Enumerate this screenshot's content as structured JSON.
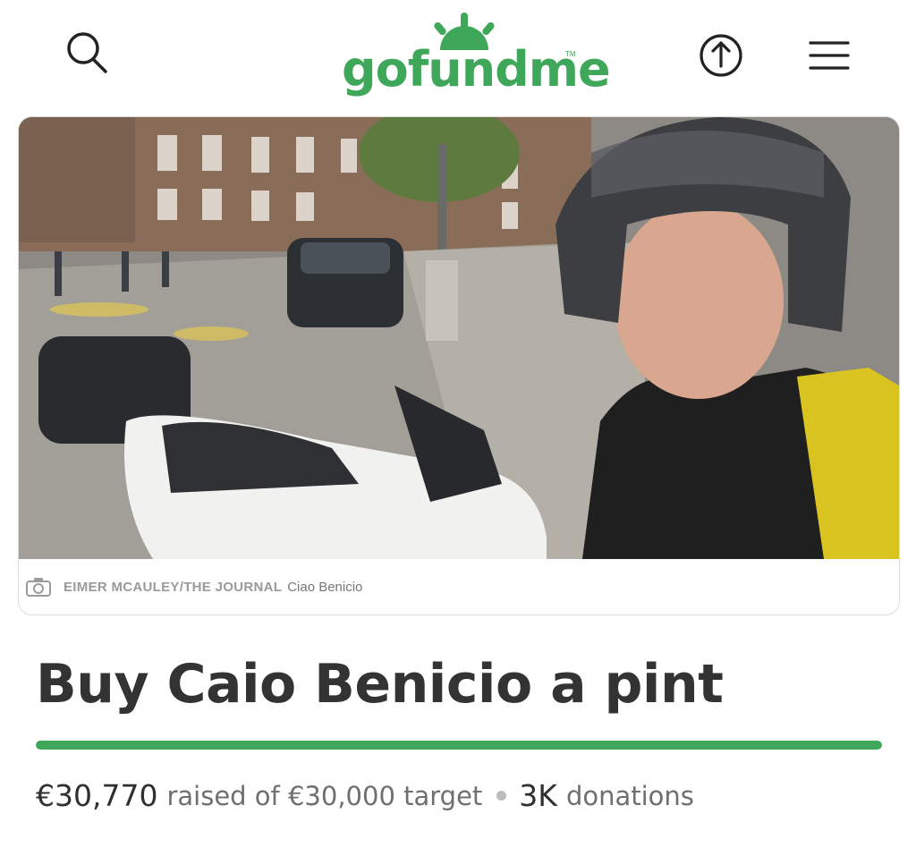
{
  "header": {
    "logo_text": "gofundme",
    "logo_tm": "TM",
    "icons": {
      "search": "search-icon",
      "share": "share-icon",
      "menu": "menu-icon"
    },
    "brand_color": "#3fa75a"
  },
  "photo": {
    "credit": "EIMER MCAULEY/THE JOURNAL",
    "caption": "Ciao Benicio"
  },
  "campaign": {
    "title": "Buy Caio Benicio a pint",
    "raised": "€30,770",
    "raised_text": "raised of €30,000 target",
    "donations_count": "3K",
    "donations_label": "donations",
    "progress_fraction": 1.0
  }
}
